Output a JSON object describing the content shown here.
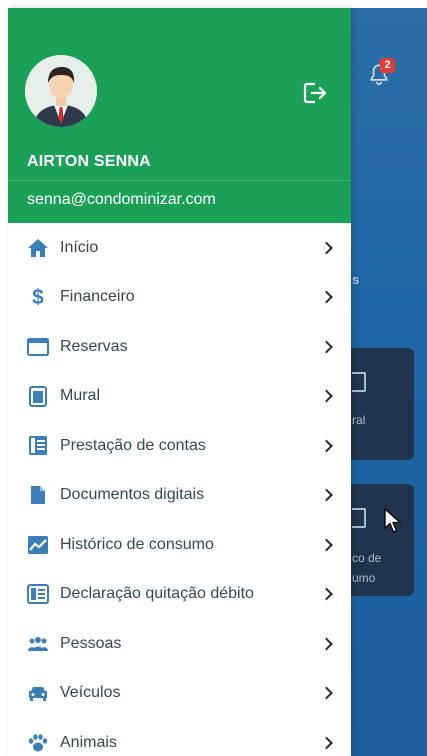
{
  "notification": {
    "count": "2"
  },
  "background": {
    "partial_heading": "s",
    "card1_label": "ral",
    "card2_label_line1": "co de",
    "card2_label_line2": "umo"
  },
  "profile": {
    "name": "AIRTON SENNA",
    "email": "senna@condominizar.com"
  },
  "colors": {
    "header_green": "#1aa157",
    "icon_blue": "#3b7fb8",
    "text": "#37474f",
    "background_blue": "#1f66a6"
  },
  "menu": [
    {
      "label": "Início",
      "icon": "home-icon"
    },
    {
      "label": "Financeiro",
      "icon": "dollar-icon"
    },
    {
      "label": "Reservas",
      "icon": "calendar-icon"
    },
    {
      "label": "Mural",
      "icon": "board-icon"
    },
    {
      "label": "Prestação de contas",
      "icon": "ledger-icon"
    },
    {
      "label": "Documentos digitais",
      "icon": "document-icon"
    },
    {
      "label": "Histórico de consumo",
      "icon": "chart-icon"
    },
    {
      "label": "Declaração quitação débito",
      "icon": "receipt-icon"
    },
    {
      "label": "Pessoas",
      "icon": "people-icon"
    },
    {
      "label": "Veículos",
      "icon": "car-icon"
    },
    {
      "label": "Animais",
      "icon": "paw-icon"
    }
  ]
}
